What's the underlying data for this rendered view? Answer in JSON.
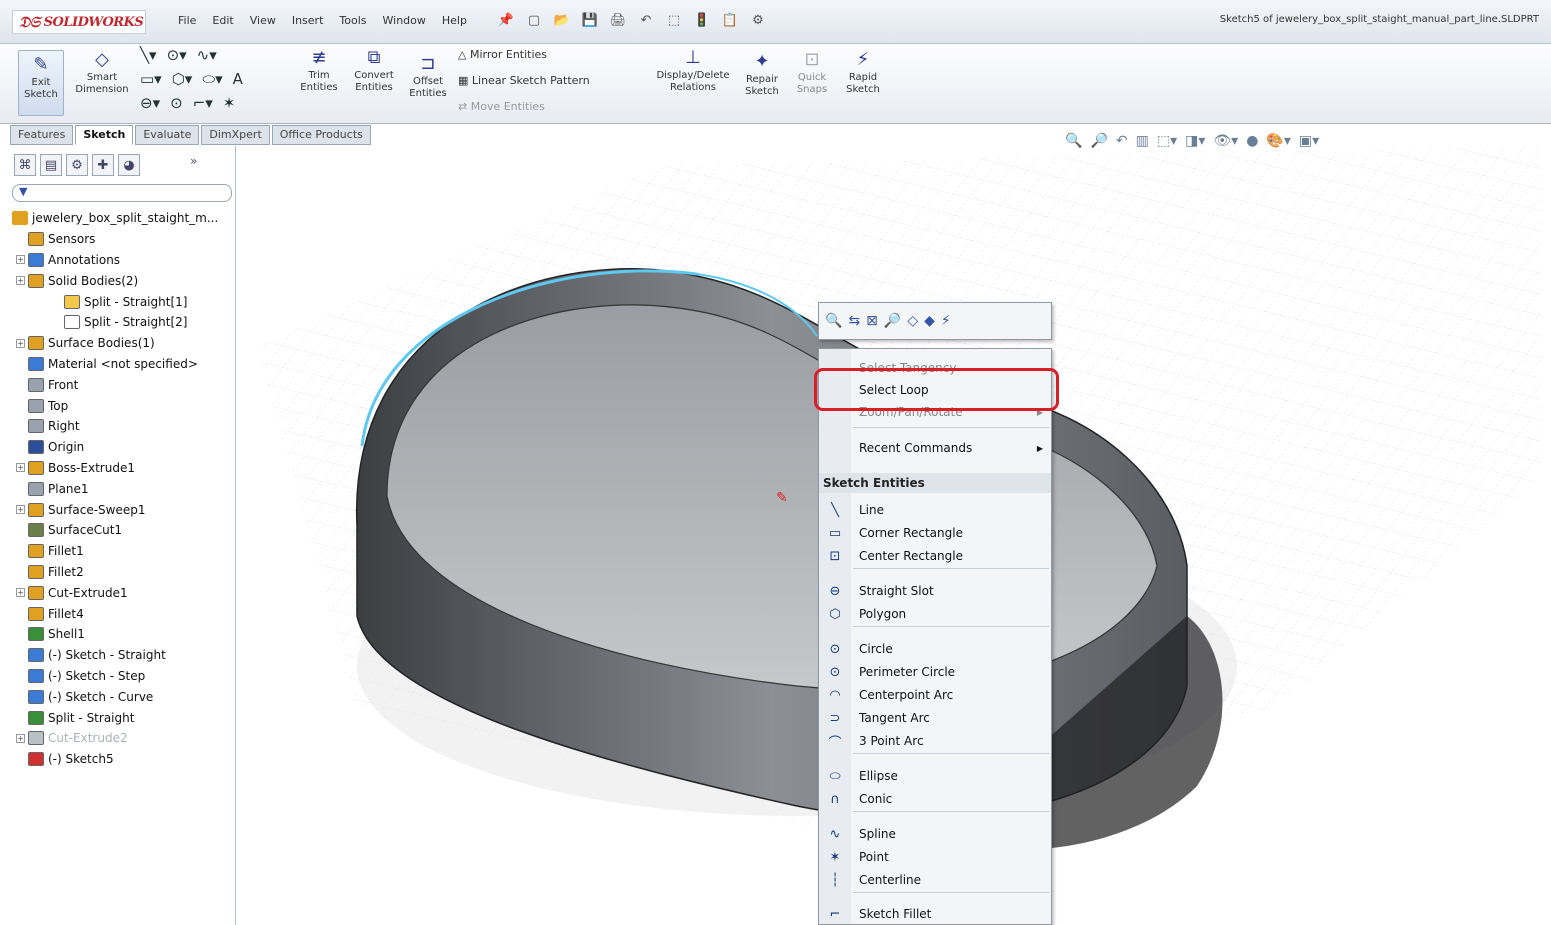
{
  "app": {
    "brand": "SOLIDWORKS",
    "window_title": "Sketch5 of jewelery_box_split_staight_manual_part_line.SLDPRT"
  },
  "menu": [
    "File",
    "Edit",
    "View",
    "Insert",
    "Tools",
    "Window",
    "Help"
  ],
  "command_manager": {
    "exit_sketch": "Exit Sketch",
    "smart_dimension": "Smart Dimension",
    "trim_entities": "Trim Entities",
    "convert_entities": "Convert Entities",
    "offset_entities": "Offset Entities",
    "mirror_entities": "Mirror Entities",
    "linear_sketch_pattern": "Linear Sketch Pattern",
    "move_entities": "Move Entities",
    "display_delete_relations": "Display/Delete Relations",
    "repair_sketch": "Repair Sketch",
    "quick_snaps": "Quick Snaps",
    "rapid_sketch": "Rapid Sketch"
  },
  "tabs": [
    "Features",
    "Sketch",
    "Evaluate",
    "DimXpert",
    "Office Products"
  ],
  "active_tab": "Sketch",
  "tree": {
    "root": "jewelery_box_split_staight_m...",
    "items": [
      {
        "label": "Sensors",
        "icon": "sensor-icon",
        "color": "#e0a020"
      },
      {
        "label": "Annotations",
        "icon": "annotation-icon",
        "color": "#3a7bd5",
        "expand": true
      },
      {
        "label": "Solid Bodies(2)",
        "icon": "solid-bodies-icon",
        "color": "#e0a020",
        "expand": true
      },
      {
        "label": "Split - Straight[1]",
        "icon": "body-icon",
        "color": "#f2c94c",
        "indent": 2
      },
      {
        "label": "Split - Straight[2]",
        "icon": "body-icon",
        "color": "#ffffff",
        "indent": 2
      },
      {
        "label": "Surface Bodies(1)",
        "icon": "surface-bodies-icon",
        "color": "#e0a020",
        "expand": true
      },
      {
        "label": "Material <not specified>",
        "icon": "material-icon",
        "color": "#3a7bd5"
      },
      {
        "label": "Front",
        "icon": "plane-icon",
        "color": "#9aa3ad"
      },
      {
        "label": "Top",
        "icon": "plane-icon",
        "color": "#9aa3ad"
      },
      {
        "label": "Right",
        "icon": "plane-icon",
        "color": "#9aa3ad"
      },
      {
        "label": "Origin",
        "icon": "origin-icon",
        "color": "#2c4e9b"
      },
      {
        "label": "Boss-Extrude1",
        "icon": "extrude-icon",
        "color": "#e0a020",
        "expand": true
      },
      {
        "label": "Plane1",
        "icon": "plane-icon",
        "color": "#9aa3ad"
      },
      {
        "label": "Surface-Sweep1",
        "icon": "sweep-icon",
        "color": "#e0a020",
        "expand": true
      },
      {
        "label": "SurfaceCut1",
        "icon": "surface-cut-icon",
        "color": "#6a7f4a"
      },
      {
        "label": "Fillet1",
        "icon": "fillet-icon",
        "color": "#e0a020"
      },
      {
        "label": "Fillet2",
        "icon": "fillet-icon",
        "color": "#e0a020"
      },
      {
        "label": "Cut-Extrude1",
        "icon": "cut-extrude-icon",
        "color": "#e0a020",
        "expand": true
      },
      {
        "label": "Fillet4",
        "icon": "fillet-icon",
        "color": "#e0a020"
      },
      {
        "label": "Shell1",
        "icon": "shell-icon",
        "color": "#3a8f3a"
      },
      {
        "label": "(-) Sketch - Straight",
        "icon": "sketch-icon",
        "color": "#3a7bd5"
      },
      {
        "label": "(-) Sketch - Step",
        "icon": "sketch-icon",
        "color": "#3a7bd5"
      },
      {
        "label": "(-) Sketch - Curve",
        "icon": "sketch-icon",
        "color": "#3a7bd5"
      },
      {
        "label": "Split - Straight",
        "icon": "split-icon",
        "color": "#3a8f3a"
      },
      {
        "label": "Cut-Extrude2",
        "icon": "cut-extrude-icon",
        "color": "#b8c0c8",
        "expand": true,
        "disabled": true
      },
      {
        "label": "(-) Sketch5",
        "icon": "sketch-icon",
        "color": "#d03030"
      }
    ]
  },
  "context_menu": {
    "partial_top": "Select Tangency",
    "select_loop": "Select Loop",
    "partial_zoom": "Zoom/Pan/Rotate",
    "recent_commands": "Recent Commands",
    "section_header": "Sketch Entities",
    "items": [
      {
        "label": "Line",
        "icon": "line-icon",
        "glyph": "╲"
      },
      {
        "label": "Corner Rectangle",
        "icon": "corner-rectangle-icon",
        "glyph": "▭"
      },
      {
        "label": "Center Rectangle",
        "icon": "center-rectangle-icon",
        "glyph": "⊡"
      },
      {
        "label": "Straight Slot",
        "icon": "straight-slot-icon",
        "glyph": "⊖"
      },
      {
        "label": "Polygon",
        "icon": "polygon-icon",
        "glyph": "⬡"
      },
      {
        "label": "Circle",
        "icon": "circle-icon",
        "glyph": "⊙"
      },
      {
        "label": "Perimeter Circle",
        "icon": "perimeter-circle-icon",
        "glyph": "⊙"
      },
      {
        "label": "Centerpoint Arc",
        "icon": "centerpoint-arc-icon",
        "glyph": "◠"
      },
      {
        "label": "Tangent Arc",
        "icon": "tangent-arc-icon",
        "glyph": "⊃"
      },
      {
        "label": "3 Point Arc",
        "icon": "three-point-arc-icon",
        "glyph": "⌒"
      },
      {
        "label": "Ellipse",
        "icon": "ellipse-icon",
        "glyph": "⬭"
      },
      {
        "label": "Conic",
        "icon": "conic-icon",
        "glyph": "∩"
      },
      {
        "label": "Spline",
        "icon": "spline-icon",
        "glyph": "∿"
      },
      {
        "label": "Point",
        "icon": "point-icon",
        "glyph": "✶"
      },
      {
        "label": "Centerline",
        "icon": "centerline-icon",
        "glyph": "┆"
      },
      {
        "label": "Sketch Fillet",
        "icon": "sketch-fillet-icon",
        "glyph": "⌐"
      }
    ]
  },
  "colors": {
    "highlight": "#d81f28",
    "accent": "#2d3e8f",
    "selection_edge": "#5fc8f0"
  }
}
